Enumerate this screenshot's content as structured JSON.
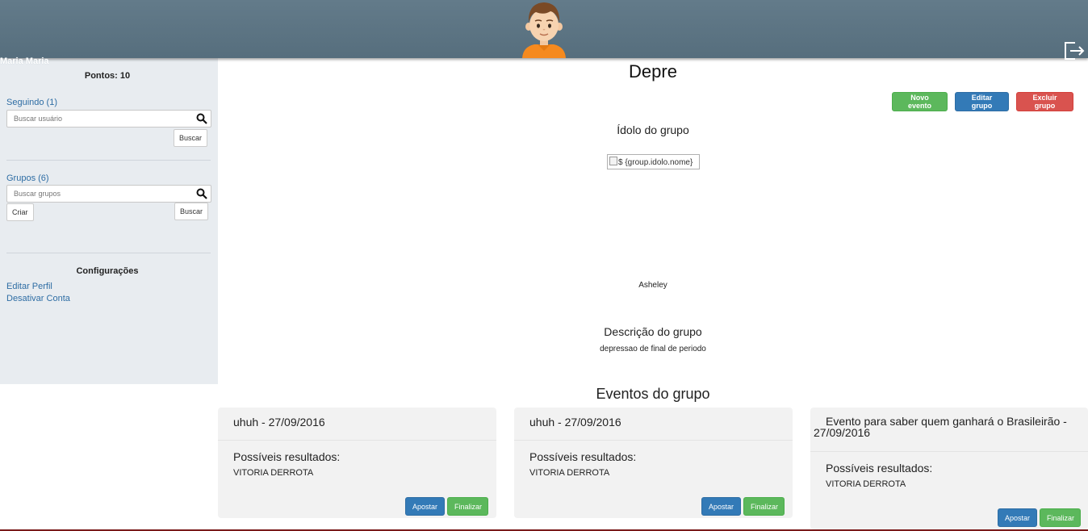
{
  "header": {
    "avatar_icon": "boy-avatar",
    "logout_icon": "logout-icon"
  },
  "user": {
    "name": "Maria Maria"
  },
  "sidebar": {
    "points": "Pontos: 10",
    "following_label": "Seguindo (1)",
    "search_user_placeholder": "Buscar usuário",
    "search_user_button": "Buscar",
    "groups_label": "Grupos (6)",
    "search_groups_placeholder": "Buscar grupos",
    "create_button": "Criar",
    "search_groups_button": "Buscar",
    "config_title": "Configurações",
    "edit_profile": "Editar Perfil",
    "deactivate_account": "Desativar Conta"
  },
  "group": {
    "title": "Depre",
    "actions": {
      "new_event": "Novo evento",
      "edit_group": "Editar grupo",
      "delete_group": "Excluir grupo"
    },
    "idol_heading": "Ídolo do grupo",
    "idol_img_alt": "$ {group.idolo.nome}",
    "idol_name": "Asheley",
    "description_heading": "Descrição do grupo",
    "description": "depressao de final de periodo",
    "events_heading": "Eventos do grupo"
  },
  "events": [
    {
      "title": "uhuh - 27/09/2016",
      "results_label": "Possíveis resultados:",
      "result": "VITORIA DERROTA",
      "bet_button": "Apostar",
      "finish_button": "Finalizar"
    },
    {
      "title": "uhuh - 27/09/2016",
      "results_label": "Possíveis resultados:",
      "result": "VITORIA DERROTA",
      "bet_button": "Apostar",
      "finish_button": "Finalizar"
    },
    {
      "title": "Evento para saber quem ganhará o Brasileirão - 27/09/2016",
      "results_label": "Possíveis resultados:",
      "result": "VITORIA DERROTA",
      "bet_button": "Apostar",
      "finish_button": "Finalizar"
    }
  ],
  "colors": {
    "header": "#5f7786",
    "sidebar": "#e8ecf0",
    "link": "#2e6da4",
    "success": "#5cb85c",
    "primary": "#337ab7",
    "danger": "#d9534f"
  }
}
